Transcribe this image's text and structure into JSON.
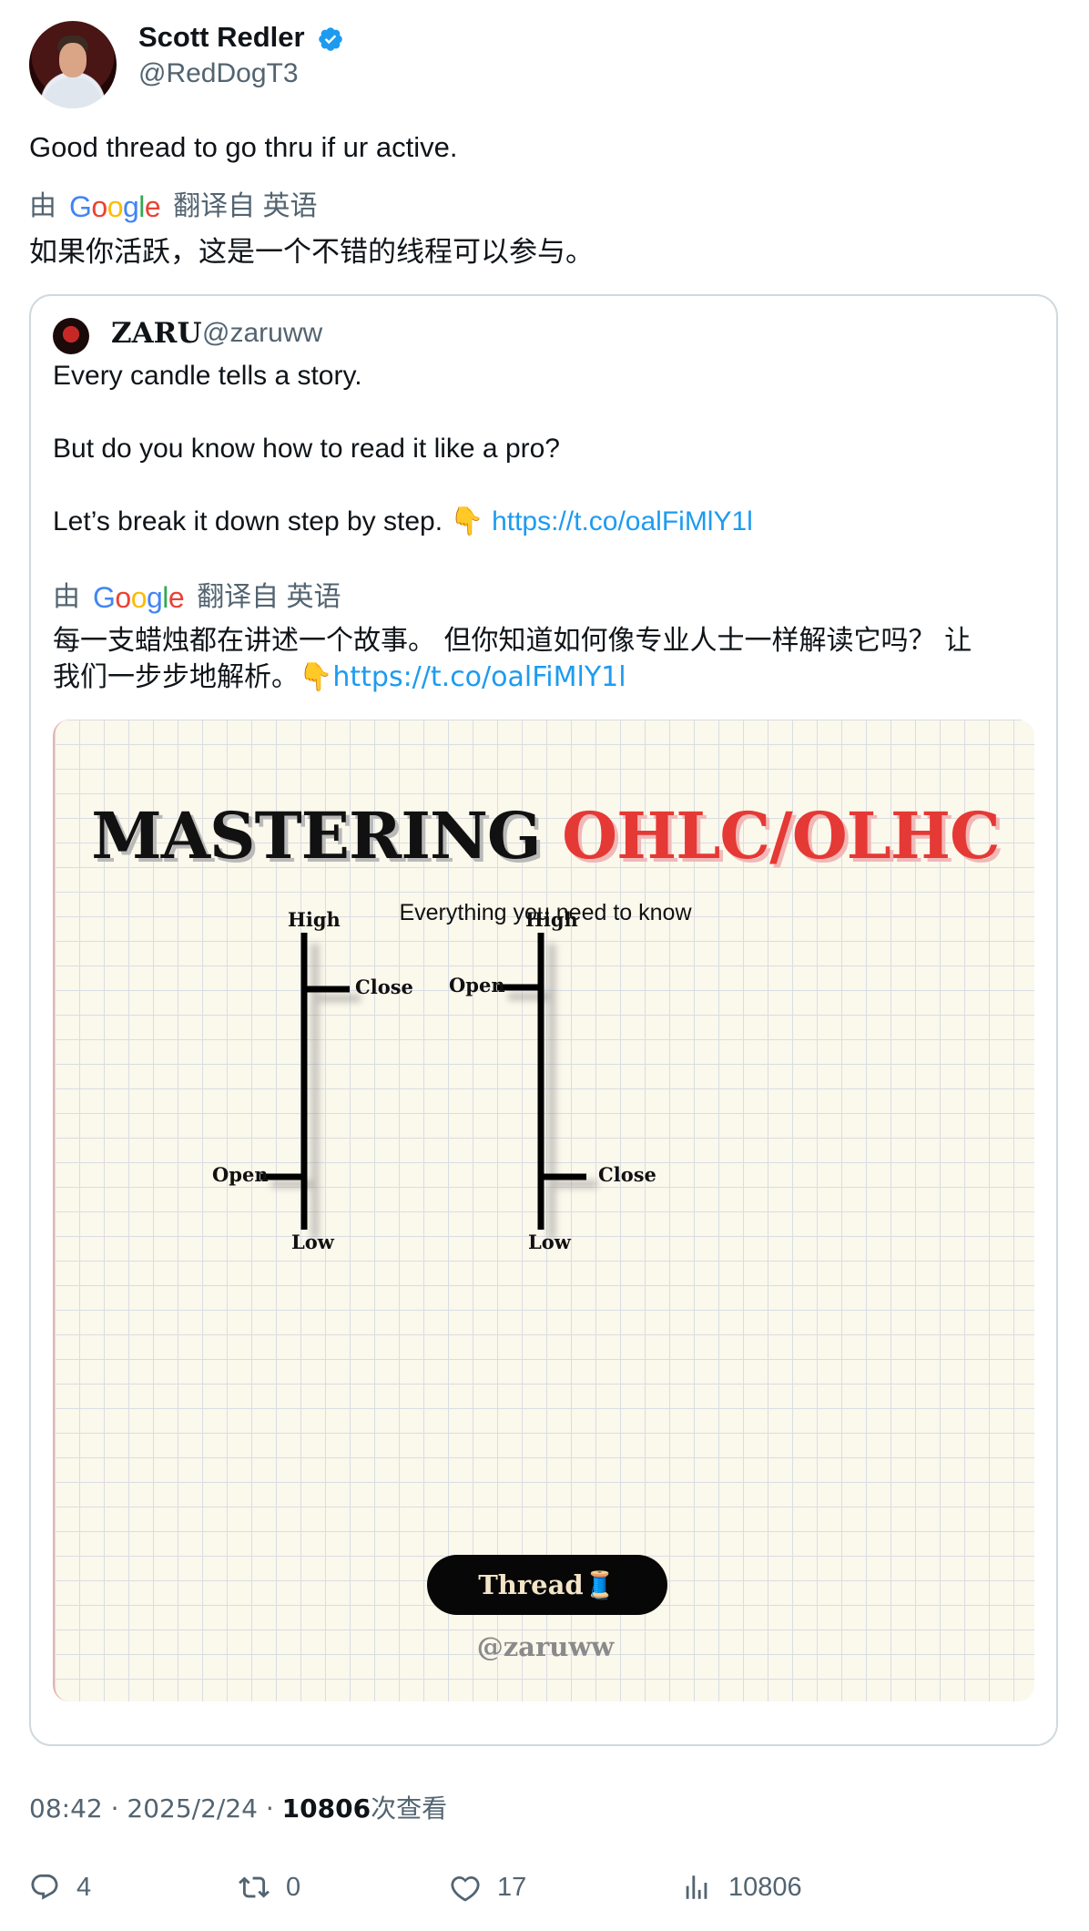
{
  "author": {
    "name": "Scott Redler",
    "handle": "@RedDogT3",
    "verified": true
  },
  "tweet": {
    "text": "Good thread to go thru if ur active.",
    "translation_prefix": "由",
    "translation_suffix": "翻译自 英语",
    "translation": "如果你活跃，这是一个不错的线程可以参与。"
  },
  "quoted": {
    "name": "ZARU",
    "handle": "@zaruww",
    "line1": "Every candle tells a story.",
    "line2": "But do you know how to read it like a pro?",
    "line3": "Let’s break it down step by step. 👇",
    "link": "https://t.co/oalFiMlY1l",
    "translation_prefix": "由",
    "translation_suffix": "翻译自 英语",
    "translation_line1": "每一支蜡烛都在讲述一个故事。 但你知道如何像专业人士一样解读它吗？ 让",
    "translation_line2": "我们一步步地解析。👇",
    "translation_link": "https://t.co/oalFiMlY1l"
  },
  "image": {
    "title_part1": "MASTERING ",
    "title_part2": "OHLC/OLHC",
    "subtitle": "Everything you need to know",
    "left_bar": {
      "high": "High",
      "close": "Close",
      "open": "Open",
      "low": "Low"
    },
    "right_bar": {
      "high": "High",
      "open": "Open",
      "close": "Close",
      "low": "Low"
    },
    "thread_label": "Thread🧵",
    "watermark": "@zaruww"
  },
  "google_logo": [
    "G",
    "o",
    "o",
    "g",
    "l",
    "e"
  ],
  "meta": {
    "time": "08:42 · 2025/2/24 · ",
    "views": "10806",
    "views_suffix": "次查看"
  },
  "actions": {
    "replies": "4",
    "retweets": "0",
    "likes": "17",
    "views": "10806"
  },
  "colors": {
    "link": "#1d9bf0",
    "verified": "#1d9bf0",
    "title_red": "#e53935",
    "muted": "#536471"
  }
}
